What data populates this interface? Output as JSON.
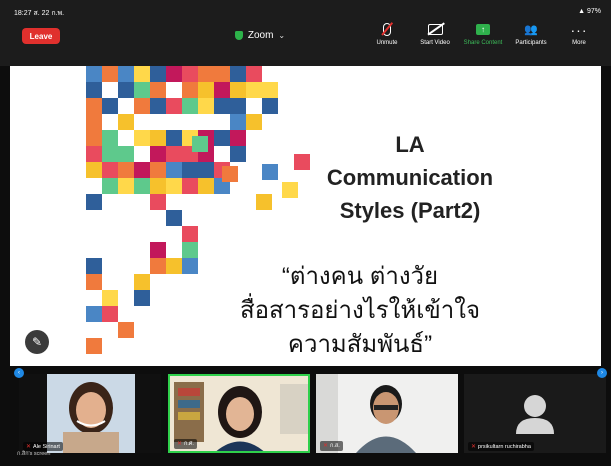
{
  "status_bar": {
    "time": "18:27 ส. 22 ก.พ.",
    "battery": "97%"
  },
  "toolbar": {
    "leave_label": "Leave",
    "meeting_title": "Zoom",
    "controls": [
      {
        "label": "Unmute",
        "icon": "mic-muted-icon"
      },
      {
        "label": "Start Video",
        "icon": "video-off-icon"
      },
      {
        "label": "Share Content",
        "icon": "share-icon"
      },
      {
        "label": "Participants",
        "icon": "participants-icon"
      },
      {
        "label": "More",
        "icon": "more-icon"
      }
    ]
  },
  "slide": {
    "title_lines": [
      "LA",
      "Communication",
      "Styles (Part2)"
    ],
    "subtitle_lines": [
      "“ต่างคน  ต่างวัย",
      "สื่อสารอย่างไรให้เข้าใจ",
      "ความสัมพันธ์”"
    ],
    "palette": [
      "#e94b5e",
      "#f07a3d",
      "#f6c12c",
      "#2f5f9a",
      "#4a86c5",
      "#5ec98c",
      "#c2185b",
      "#ffd84a"
    ]
  },
  "annotate": {
    "icon": "pencil-icon"
  },
  "gallery": {
    "participants": [
      {
        "name": "Ale Sirinart",
        "muted": true
      },
      {
        "name": "ก.ศ.",
        "muted": true
      },
      {
        "name": "ก.ส.",
        "muted": true
      },
      {
        "name": "prsikultarn ruchirabha",
        "muted": true
      }
    ],
    "self_label": "ก.สิก's screen"
  }
}
